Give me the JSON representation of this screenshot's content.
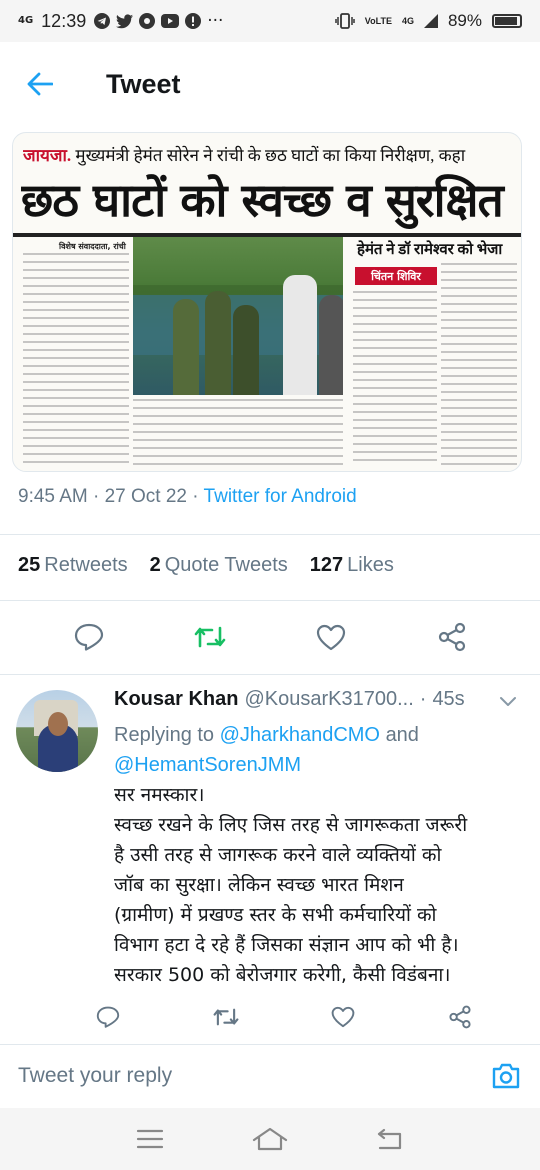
{
  "status_bar": {
    "network_left": "4G",
    "time": "12:39",
    "notification_icons": [
      "telegram-icon",
      "twitter-icon",
      "photos-icon",
      "youtube-icon",
      "alert-icon"
    ],
    "more": "···",
    "volte": "VoLTE",
    "network_right": "4G",
    "battery": "89%"
  },
  "header": {
    "title": "Tweet"
  },
  "media": {
    "headline_kicker": "जायजा.",
    "headline_top": "मुख्यमंत्री हेमंत सोरेन ने रांची के छठ घाटों का किया निरीक्षण, कहा",
    "headline_main": "छठ घाटों को स्वच्छ व सुरक्षित रखें",
    "byline": "विशेष संवाददाता, रांची",
    "sub_headline": "हेमंत ने डॉ रामेश्वर को भेजा",
    "tag": "चिंतन शिविर"
  },
  "tweet_meta": {
    "time": "9:45 AM",
    "sep1": " · ",
    "date": "27 Oct 22",
    "sep2": " · ",
    "source": "Twitter for Android"
  },
  "stats": {
    "retweets_count": "25",
    "retweets_label": "Retweets",
    "quotes_count": "2",
    "quotes_label": "Quote Tweets",
    "likes_count": "127",
    "likes_label": "Likes"
  },
  "reply": {
    "name": "Kousar Khan",
    "handle": "@KousarK31700...",
    "time_sep": "·",
    "time": "45s",
    "replying_prefix": "Replying to",
    "mention1": "@JharkhandCMO",
    "and": "and",
    "mention2": "@HemantSorenJMM",
    "lines": [
      "सर नमस्कार।",
      "स्वच्छ रखने के लिए जिस तरह से जागरूकता जरूरी",
      "है उसी तरह से जागरूक करने वाले व्यक्तियों को",
      "जॉब का सुरक्षा। लेकिन स्वच्छ भारत मिशन",
      "(ग्रामीण) में प्रखण्ड स्तर के सभी कर्मचारियों को",
      "विभाग हटा दे रहे हैं जिसका संज्ञान आप को भी है।",
      "सरकार 500 को बेरोजगार करेगी, कैसी विडंबना।"
    ]
  },
  "compose": {
    "placeholder": "Tweet your reply"
  },
  "colors": {
    "accent": "#1da1f2",
    "retweet": "#17bf63",
    "muted": "#657786",
    "text": "#14171a"
  }
}
